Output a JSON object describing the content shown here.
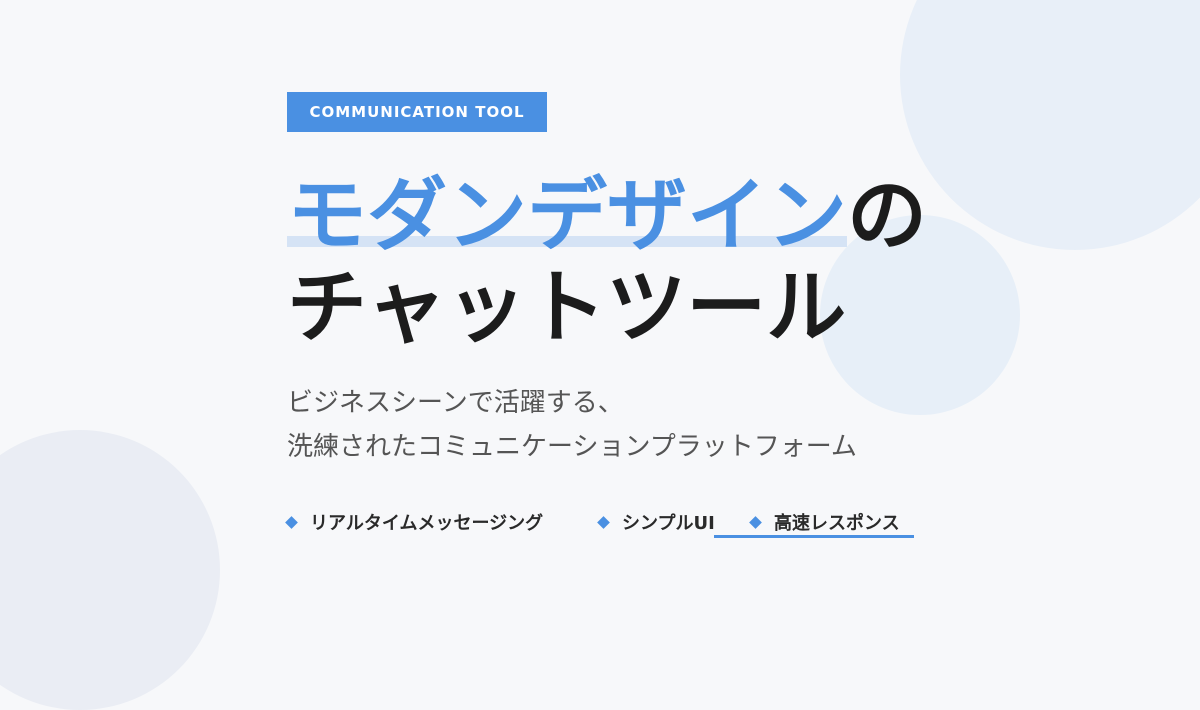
{
  "badge": {
    "label": "COMMUNICATION TOOL"
  },
  "headline": {
    "highlight": "モダンデザイン",
    "suffix": "の",
    "line2": "チャットツール"
  },
  "subtitle": {
    "line1": "ビジネスシーンで活躍する、",
    "line2": "洗練されたコミュニケーションプラットフォーム"
  },
  "features": [
    {
      "label": "リアルタイムメッセージング"
    },
    {
      "label": "シンプルUI"
    },
    {
      "label": "高速レスポンス"
    }
  ],
  "colors": {
    "accent": "#4a90e2",
    "highlight_bg": "#d5e3f5",
    "text_dark": "#1c1c1c",
    "text_muted": "#555555",
    "background": "#f7f8fa"
  }
}
